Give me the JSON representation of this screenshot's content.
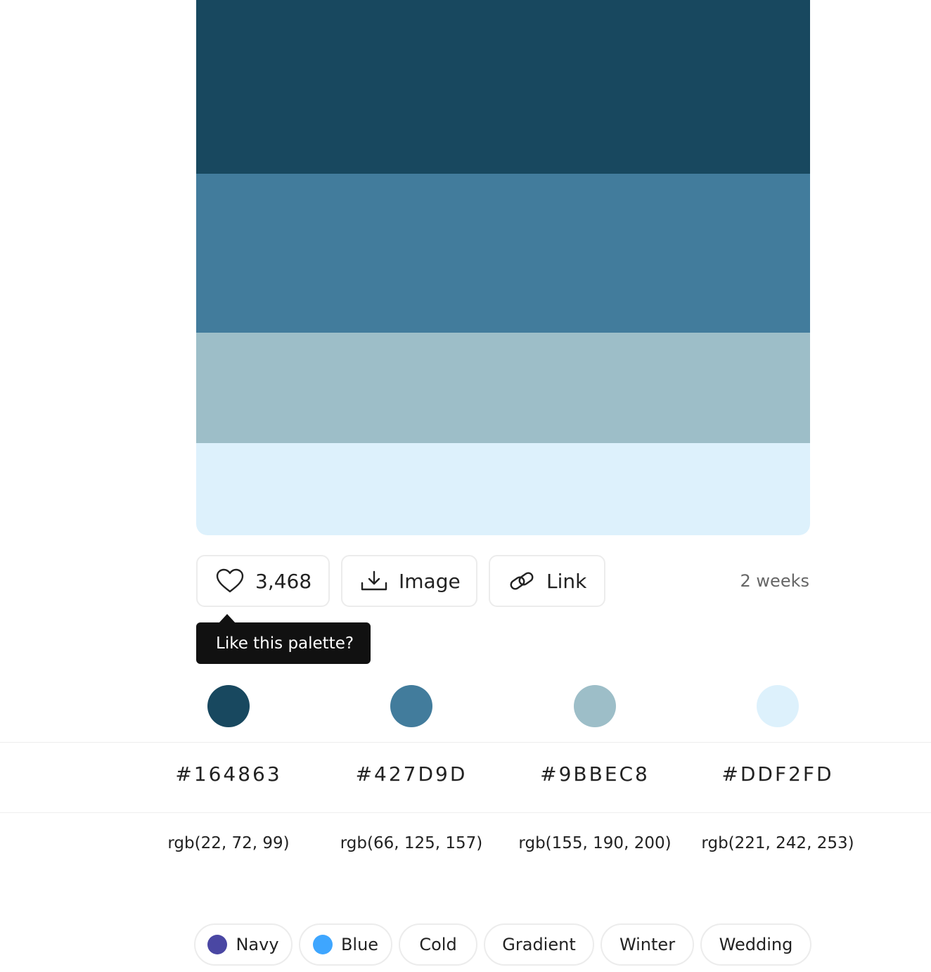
{
  "palette": {
    "colors": [
      {
        "hex": "#164863",
        "rgb": "rgb(22, 72, 99)",
        "swatch": "#18485f"
      },
      {
        "hex": "#427D9D",
        "rgb": "rgb(66, 125, 157)",
        "swatch": "#427c9c"
      },
      {
        "hex": "#9BBEC8",
        "rgb": "rgb(155, 190, 200)",
        "swatch": "#9dbec8"
      },
      {
        "hex": "#DDF2FD",
        "rgb": "rgb(221, 242, 253)",
        "swatch": "#ddf1fc"
      }
    ]
  },
  "actions": {
    "likes": "3,468",
    "image_label": "Image",
    "link_label": "Link",
    "time": "2 weeks",
    "tooltip": "Like this palette?"
  },
  "tags": [
    {
      "label": "Navy",
      "dot": "#4a47a3"
    },
    {
      "label": "Blue",
      "dot": "#3ea6ff"
    },
    {
      "label": "Cold"
    },
    {
      "label": "Gradient"
    },
    {
      "label": "Winter"
    },
    {
      "label": "Wedding"
    }
  ],
  "icons": {
    "like": "heart-icon",
    "image": "download-icon",
    "link": "link-icon"
  }
}
